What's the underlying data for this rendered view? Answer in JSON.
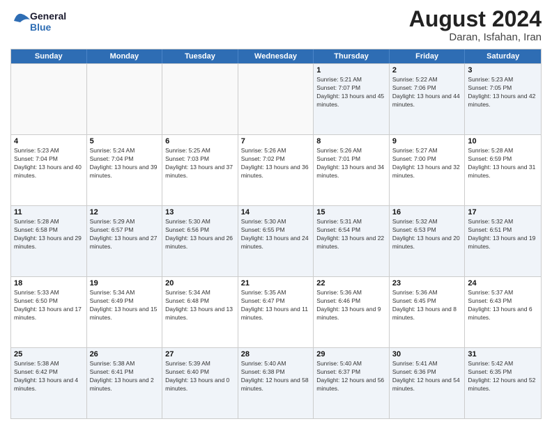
{
  "header": {
    "logo_general": "General",
    "logo_blue": "Blue",
    "month_year": "August 2024",
    "location": "Daran, Isfahan, Iran"
  },
  "weekdays": [
    "Sunday",
    "Monday",
    "Tuesday",
    "Wednesday",
    "Thursday",
    "Friday",
    "Saturday"
  ],
  "rows": [
    [
      {
        "day": "",
        "empty": true
      },
      {
        "day": "",
        "empty": true
      },
      {
        "day": "",
        "empty": true
      },
      {
        "day": "",
        "empty": true
      },
      {
        "day": "1",
        "sunrise": "5:21 AM",
        "sunset": "7:07 PM",
        "daylight": "13 hours and 45 minutes."
      },
      {
        "day": "2",
        "sunrise": "5:22 AM",
        "sunset": "7:06 PM",
        "daylight": "13 hours and 44 minutes."
      },
      {
        "day": "3",
        "sunrise": "5:23 AM",
        "sunset": "7:05 PM",
        "daylight": "13 hours and 42 minutes."
      }
    ],
    [
      {
        "day": "4",
        "sunrise": "5:23 AM",
        "sunset": "7:04 PM",
        "daylight": "13 hours and 40 minutes."
      },
      {
        "day": "5",
        "sunrise": "5:24 AM",
        "sunset": "7:04 PM",
        "daylight": "13 hours and 39 minutes."
      },
      {
        "day": "6",
        "sunrise": "5:25 AM",
        "sunset": "7:03 PM",
        "daylight": "13 hours and 37 minutes."
      },
      {
        "day": "7",
        "sunrise": "5:26 AM",
        "sunset": "7:02 PM",
        "daylight": "13 hours and 36 minutes."
      },
      {
        "day": "8",
        "sunrise": "5:26 AM",
        "sunset": "7:01 PM",
        "daylight": "13 hours and 34 minutes."
      },
      {
        "day": "9",
        "sunrise": "5:27 AM",
        "sunset": "7:00 PM",
        "daylight": "13 hours and 32 minutes."
      },
      {
        "day": "10",
        "sunrise": "5:28 AM",
        "sunset": "6:59 PM",
        "daylight": "13 hours and 31 minutes."
      }
    ],
    [
      {
        "day": "11",
        "sunrise": "5:28 AM",
        "sunset": "6:58 PM",
        "daylight": "13 hours and 29 minutes."
      },
      {
        "day": "12",
        "sunrise": "5:29 AM",
        "sunset": "6:57 PM",
        "daylight": "13 hours and 27 minutes."
      },
      {
        "day": "13",
        "sunrise": "5:30 AM",
        "sunset": "6:56 PM",
        "daylight": "13 hours and 26 minutes."
      },
      {
        "day": "14",
        "sunrise": "5:30 AM",
        "sunset": "6:55 PM",
        "daylight": "13 hours and 24 minutes."
      },
      {
        "day": "15",
        "sunrise": "5:31 AM",
        "sunset": "6:54 PM",
        "daylight": "13 hours and 22 minutes."
      },
      {
        "day": "16",
        "sunrise": "5:32 AM",
        "sunset": "6:53 PM",
        "daylight": "13 hours and 20 minutes."
      },
      {
        "day": "17",
        "sunrise": "5:32 AM",
        "sunset": "6:51 PM",
        "daylight": "13 hours and 19 minutes."
      }
    ],
    [
      {
        "day": "18",
        "sunrise": "5:33 AM",
        "sunset": "6:50 PM",
        "daylight": "13 hours and 17 minutes."
      },
      {
        "day": "19",
        "sunrise": "5:34 AM",
        "sunset": "6:49 PM",
        "daylight": "13 hours and 15 minutes."
      },
      {
        "day": "20",
        "sunrise": "5:34 AM",
        "sunset": "6:48 PM",
        "daylight": "13 hours and 13 minutes."
      },
      {
        "day": "21",
        "sunrise": "5:35 AM",
        "sunset": "6:47 PM",
        "daylight": "13 hours and 11 minutes."
      },
      {
        "day": "22",
        "sunrise": "5:36 AM",
        "sunset": "6:46 PM",
        "daylight": "13 hours and 9 minutes."
      },
      {
        "day": "23",
        "sunrise": "5:36 AM",
        "sunset": "6:45 PM",
        "daylight": "13 hours and 8 minutes."
      },
      {
        "day": "24",
        "sunrise": "5:37 AM",
        "sunset": "6:43 PM",
        "daylight": "13 hours and 6 minutes."
      }
    ],
    [
      {
        "day": "25",
        "sunrise": "5:38 AM",
        "sunset": "6:42 PM",
        "daylight": "13 hours and 4 minutes."
      },
      {
        "day": "26",
        "sunrise": "5:38 AM",
        "sunset": "6:41 PM",
        "daylight": "13 hours and 2 minutes."
      },
      {
        "day": "27",
        "sunrise": "5:39 AM",
        "sunset": "6:40 PM",
        "daylight": "13 hours and 0 minutes."
      },
      {
        "day": "28",
        "sunrise": "5:40 AM",
        "sunset": "6:38 PM",
        "daylight": "12 hours and 58 minutes."
      },
      {
        "day": "29",
        "sunrise": "5:40 AM",
        "sunset": "6:37 PM",
        "daylight": "12 hours and 56 minutes."
      },
      {
        "day": "30",
        "sunrise": "5:41 AM",
        "sunset": "6:36 PM",
        "daylight": "12 hours and 54 minutes."
      },
      {
        "day": "31",
        "sunrise": "5:42 AM",
        "sunset": "6:35 PM",
        "daylight": "12 hours and 52 minutes."
      }
    ]
  ]
}
